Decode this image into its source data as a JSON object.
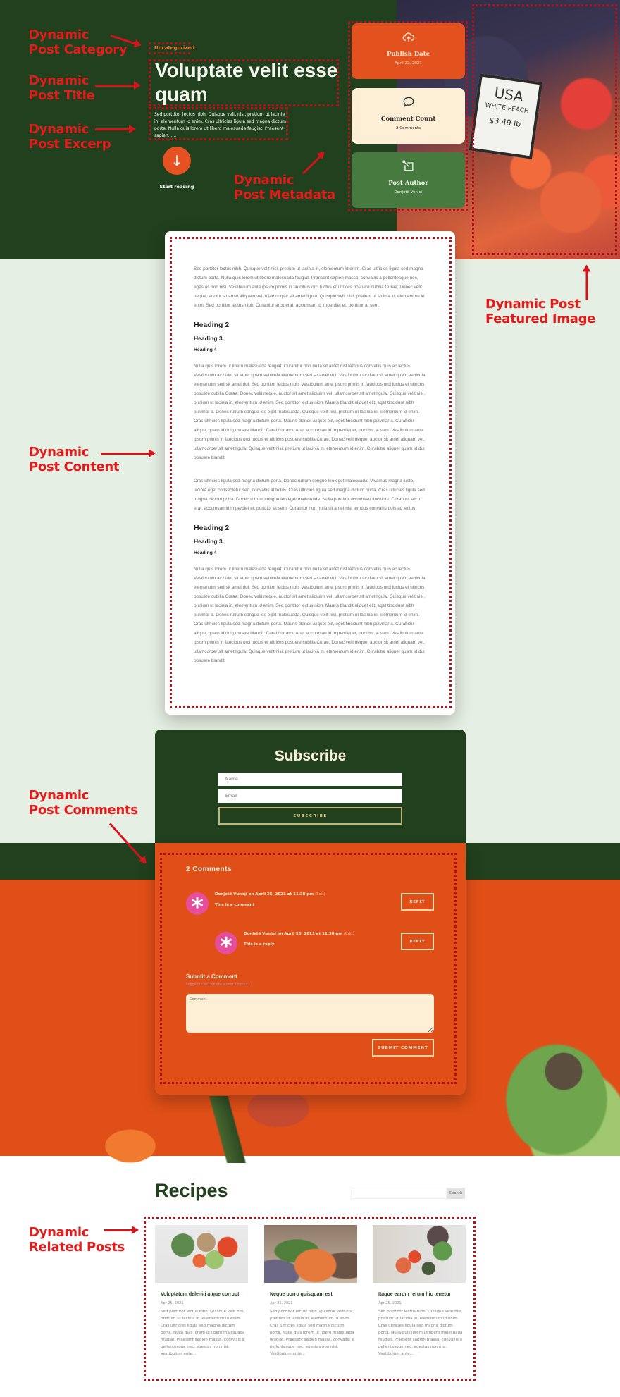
{
  "annotations": {
    "category": [
      "Dynamic",
      "Post Category"
    ],
    "title": [
      "Dynamic",
      "Post Title"
    ],
    "excerpt": [
      "Dynamic",
      "Post Excerp"
    ],
    "metadata": [
      "Dynamic",
      "Post Metadata"
    ],
    "featured_image": [
      "Dynamic Post",
      "Featured Image"
    ],
    "content": [
      "Dynamic",
      "Post Content"
    ],
    "comments": [
      "Dynamic",
      "Post Comments"
    ],
    "related": [
      "Dynamic",
      "Related Posts"
    ]
  },
  "hero": {
    "category": "Uncategorized",
    "title": "Voluptate velit esse quam",
    "excerpt": "Sed porttitor lectus nibh. Quisque velit nisi, pretium ut lacinia in, elementum id enim. Cras ultricies ligula sed magna dictum porta. Nulla quis lorem ut libero malesuada feugiat. Praesent sapien......",
    "start_icon": "arrow-down-icon",
    "start_label": "Start reading",
    "featured_image_sign": [
      "USA",
      "WHITE PEACH",
      "$3.49 lb"
    ]
  },
  "metadata": [
    {
      "icon": "cloud-upload-icon",
      "label": "Publish Date",
      "value": "April 22, 2021"
    },
    {
      "icon": "speech-bubble-icon",
      "label": "Comment Count",
      "value": "2 Comments"
    },
    {
      "icon": "pencil-edit-icon",
      "label": "Post Author",
      "value": "Donjetë Vuniqi"
    }
  ],
  "content": {
    "p1": "Sed porttitor lectus nibh. Quisque velit nisi, pretium ut lacinia in, elementum id enim. Cras ultricies ligula sed magna dictum porta. Nulla quis lorem ut libero malesuada feugiat. Praesent sapien massa, convallis a pellentesque nec, egestas non nisi. Vestibulum ante ipsum primis in faucibus orci luctus et ultrices posuere cubilia Curae; Donec velit neque, auctor sit amet aliquam vel, ullamcorper sit amet ligula. Quisque velit nisi, pretium ut lacinia in, elementum id enim. Sed porttitor lectus nibh. Curabitur arcu erat, accumsan id imperdiet et, porttitor at sem.",
    "h2": "Heading 2",
    "h3": "Heading 3",
    "h4": "Heading 4",
    "p2": "Nulla quis lorem ut libero malesuada feugiat. Curabitur non nulla sit amet nisl tempus convallis quis ac lectus. Vestibulum ac diam sit amet quam vehicula elementum sed sit amet dui. Vestibulum ac diam sit amet quam vehicula elementum sed sit amet dui. Sed porttitor lectus nibh. Vestibulum ante ipsum primis in faucibus orci luctus et ultrices posuere cubilia Curae; Donec velit neque, auctor sit amet aliquam vel, ullamcorper sit amet ligula. Quisque velit nisi, pretium ut lacinia in, elementum id enim. Sed porttitor lectus nibh. Mauris blandit aliquet elit, eget tincidunt nibh pulvinar a. Donec rutrum congue leo eget malesuada. Quisque velit nisi, pretium ut lacinia in, elementum id enim. Cras ultricies ligula sed magna dictum porta. Mauris blandit aliquet elit, eget tincidunt nibh pulvinar a. Curabitur aliquet quam id dui posuere blandit. Curabitur arcu erat, accumsan id imperdiet et, porttitor at sem. Vestibulum ante ipsum primis in faucibus orci luctus et ultrices posuere cubilia Curae; Donec velit neque, auctor sit amet aliquam vel, ullamcorper sit amet ligula. Quisque velit nisi, pretium ut lacinia in, elementum id enim. Curabitur aliquet quam id dui posuere blandit.",
    "p3": "Cras ultricies ligula sed magna dictum porta. Donec rutrum congue leo eget malesuada. Vivamus magna justo, lacinia eget consectetur sed, convallis at tellus. Cras ultricies ligula sed magna dictum porta. Cras ultricies ligula sed magna dictum porta. Donec rutrum congue leo eget malesuada. Nulla porttitor accumsan tincidunt. Curabitur arcu erat, accumsan id imperdiet et, porttitor at sem. Curabitur non nulla sit amet nisl tempus convallis quis ac lectus.",
    "h2b": "Heading 2",
    "h3b": "Heading 3",
    "h4b": "Heading 4",
    "p4": "Nulla quis lorem ut libero malesuada feugiat. Curabitur non nulla sit amet nisl tempus convallis quis ac lectus. Vestibulum ac diam sit amet quam vehicula elementum sed sit amet dui. Vestibulum ac diam sit amet quam vehicula elementum sed sit amet dui. Sed porttitor lectus nibh. Vestibulum ante ipsum primis in faucibus orci luctus et ultrices posuere cubilia Curae; Donec velit neque, auctor sit amet aliquam vel, ullamcorper sit amet ligula. Quisque velit nisi, pretium ut lacinia in, elementum id enim. Sed porttitor lectus nibh. Mauris blandit aliquet elit, eget tincidunt nibh pulvinar a. Donec rutrum congue leo eget malesuada. Quisque velit nisi, pretium ut lacinia in, elementum id enim. Cras ultricies ligula sed magna dictum porta. Mauris blandit aliquet elit, eget tincidunt nibh pulvinar a. Curabitur aliquet quam id dui posuere blandit. Curabitur arcu erat, accumsan id imperdiet et, porttitor at sem. Vestibulum ante ipsum primis in faucibus orci luctus et ultrices posuere cubilia Curae; Donec velit neque, auctor sit amet aliquam vel, ullamcorper sit amet ligula. Quisque velit nisi, pretium ut lacinia in, elementum id enim. Curabitur aliquet quam id dui posuere blandit."
  },
  "subscribe": {
    "title": "Subscribe",
    "name_placeholder": "Name",
    "email_placeholder": "Email",
    "button": "SUBSCRIBE"
  },
  "comments": {
    "count_label": "2 Comments",
    "items": [
      {
        "author_date": "Donjetë Vuniqi on April 25, 2021 at 11:38 pm",
        "edit": "(Edit)",
        "text": "This is a comment",
        "reply": "REPLY"
      },
      {
        "author_date": "Donjetë Vuniqi on April 25, 2021 at 11:38 pm",
        "edit": "(Edit)",
        "text": "This is a reply",
        "reply": "REPLY"
      }
    ],
    "submit_title": "Submit a Comment",
    "logged_in": "Logged in as Donjetë Vuniqi. Log out?",
    "comment_placeholder": "Comment",
    "submit_button": "SUBMIT COMMENT"
  },
  "recipes": {
    "title": "Recipes",
    "search_button": "Search",
    "posts": [
      {
        "title": "Voluptatum deleniti atque corrupti",
        "date": "Apr 25, 2021",
        "excerpt": "Sed porttitor lectus nibh. Quisque velit nisi, pretium ut lacinia in, elementum id enim. Cras ultricies ligula sed magna dictum porta. Nulla quis lorem ut libero malesuada feugiat. Praesent sapien massa, convallis a pellentesque nec, egestas non nisi. Vestibulum ante..."
      },
      {
        "title": "Neque porro quisquam est",
        "date": "Apr 25, 2021",
        "excerpt": "Sed porttitor lectus nibh. Quisque velit nisi, pretium ut lacinia in, elementum id enim. Cras ultricies ligula sed magna dictum porta. Nulla quis lorem ut libero malesuada feugiat. Praesent sapien massa, convallis a pellentesque nec, egestas non nisi. Vestibulum ante..."
      },
      {
        "title": "Itaque earum rerum hic tenetur",
        "date": "Apr 25, 2021",
        "excerpt": "Sed porttitor lectus nibh. Quisque velit nisi, pretium ut lacinia in, elementum id enim. Cras ultricies ligula sed magna dictum porta. Nulla quis lorem ut libero malesuada feugiat. Praesent sapien massa, convallis a pellentesque nec, egestas non nisi. Vestibulum ante..."
      }
    ]
  },
  "colors": {
    "dark_green": "#21401d",
    "orange": "#e04f17",
    "cream": "#fdeed6",
    "mid_green": "#477a3f",
    "light_bg": "#e6efe3",
    "annotation_red": "#e31b1b"
  }
}
